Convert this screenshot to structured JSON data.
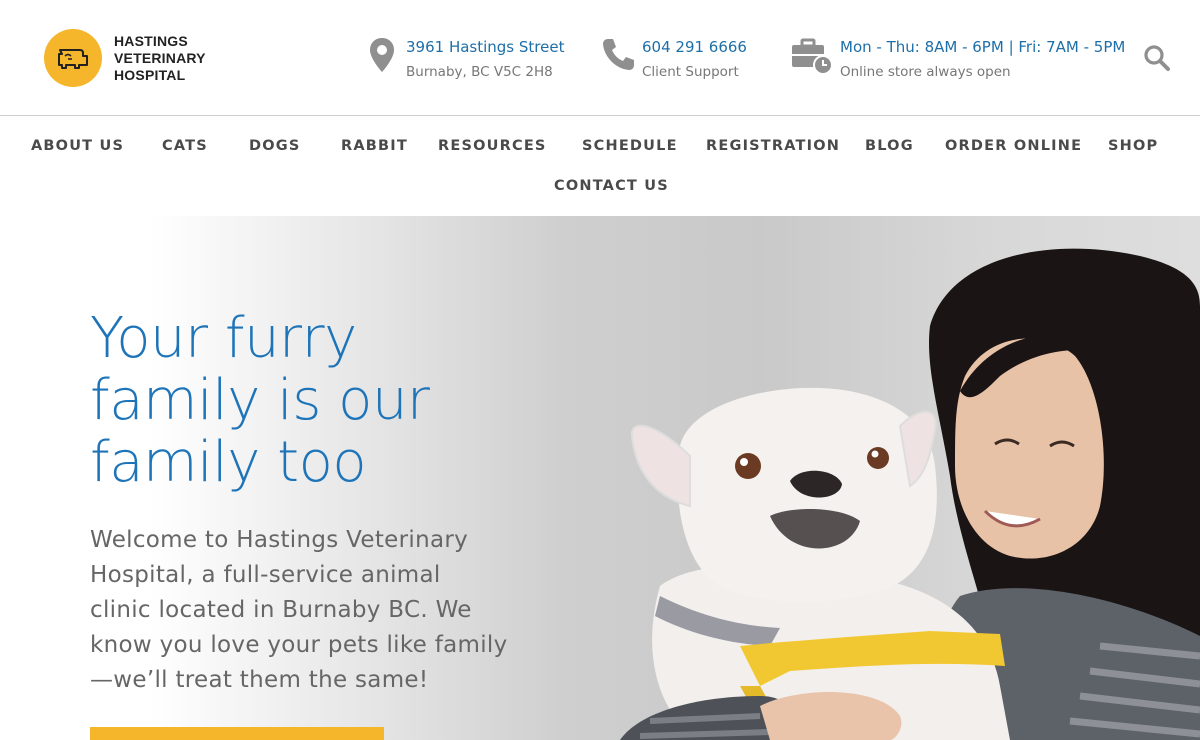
{
  "header": {
    "logo_lines": [
      "HASTINGS",
      "VETERINARY",
      "HOSPITAL"
    ],
    "address": {
      "line1": "3961 Hastings Street",
      "line2": "Burnaby, BC V5C 2H8",
      "icon": "map-pin-icon"
    },
    "phone": {
      "line1": "604 291 6666",
      "line2": "Client Support",
      "icon": "phone-icon"
    },
    "hours": {
      "line1": "Mon - Thu: 8AM - 6PM | Fri: 7AM - 5PM",
      "line2": "Online store always open",
      "icon": "briefcase-clock-icon"
    },
    "search_icon": "search-icon"
  },
  "nav": {
    "items": [
      "ABOUT US",
      "CATS",
      "DOGS",
      "RABBIT",
      "RESOURCES",
      "SCHEDULE",
      "REGISTRATION",
      "BLOG",
      "ORDER ONLINE",
      "SHOP",
      "CONTACT US"
    ]
  },
  "hero": {
    "title_lines": [
      "Your furry",
      "family is our",
      "family too"
    ],
    "text_lines": [
      "Welcome to Hastings Veterinary",
      "Hospital, a full-service animal",
      "clinic located in Burnaby BC. We",
      "know you love your pets like family",
      "—we’ll treat them the same!"
    ],
    "cta_label": ""
  },
  "colors": {
    "accent": "#f6b62c",
    "brand_blue": "#1e74b8",
    "nav_text": "#4a4a4a"
  }
}
